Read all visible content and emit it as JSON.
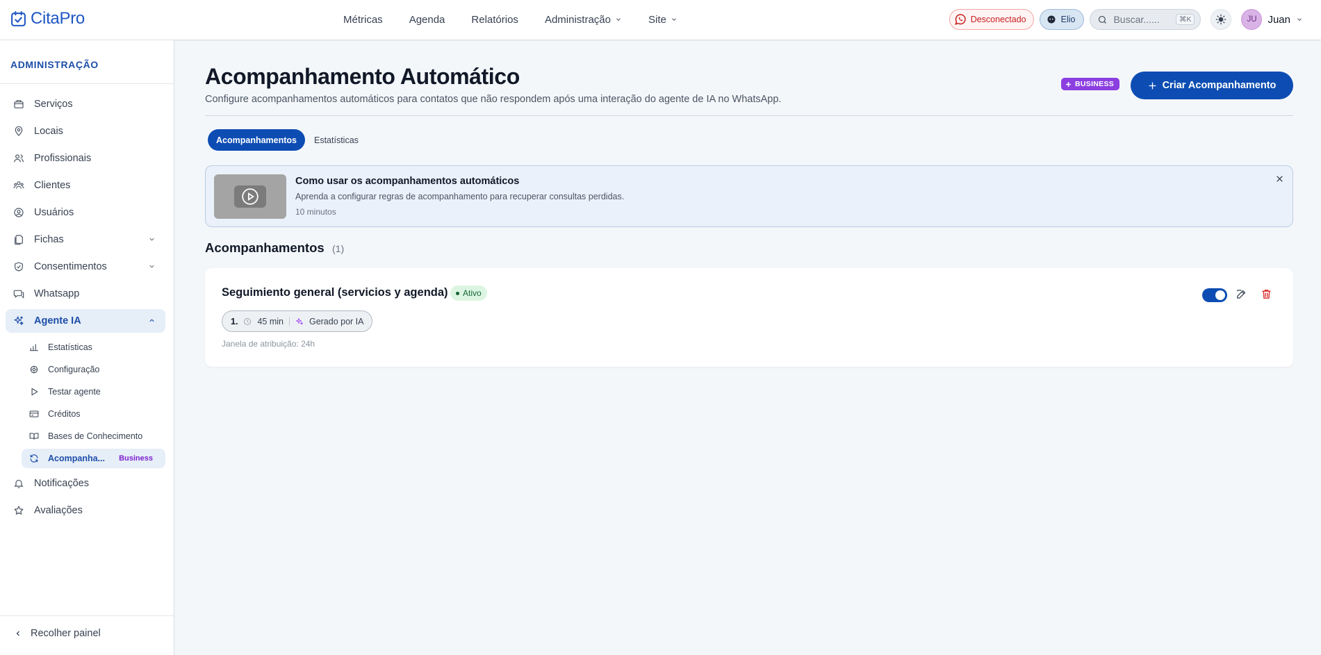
{
  "app": {
    "logo": "CitaPro"
  },
  "nav": {
    "items": [
      "Métricas",
      "Agenda",
      "Relatórios",
      "Administração",
      "Site"
    ]
  },
  "topbar": {
    "whatsapp_status": "Desconectado",
    "agent_name": "Elio",
    "search_placeholder": "Buscar......",
    "search_shortcut": "⌘K",
    "user_initials": "JU",
    "user_name": "Juan"
  },
  "sidebar": {
    "title": "ADMINISTRAÇÃO",
    "items": [
      {
        "label": "Serviços",
        "icon": "box-icon"
      },
      {
        "label": "Locais",
        "icon": "map-pin-icon"
      },
      {
        "label": "Profissionais",
        "icon": "users-icon"
      },
      {
        "label": "Clientes",
        "icon": "clients-icon"
      },
      {
        "label": "Usuários",
        "icon": "user-circle-icon"
      },
      {
        "label": "Fichas",
        "icon": "files-icon"
      },
      {
        "label": "Consentimentos",
        "icon": "shield-check-icon"
      },
      {
        "label": "Whatsapp",
        "icon": "chat-icon"
      },
      {
        "label": "Agente IA",
        "icon": "sparkles-icon"
      }
    ],
    "subitems": [
      {
        "label": "Estatísticas",
        "icon": "bar-chart-icon"
      },
      {
        "label": "Configuração",
        "icon": "settings-icon"
      },
      {
        "label": "Testar agente",
        "icon": "play-icon"
      },
      {
        "label": "Créditos",
        "icon": "credit-card-icon"
      },
      {
        "label": "Bases de Conhecimento",
        "icon": "book-icon"
      },
      {
        "label": "Acompanha...",
        "icon": "refresh-icon",
        "badge": "Business"
      }
    ],
    "bottom_items": [
      {
        "label": "Notificações",
        "icon": "bell-icon"
      },
      {
        "label": "Avaliações",
        "icon": "star-icon"
      }
    ],
    "collapse_label": "Recolher painel"
  },
  "page": {
    "title": "Acompanhamento Automático",
    "subtitle": "Configure acompanhamentos automáticos para contatos que não respondem após uma interação do agente de IA no WhatsApp.",
    "plan_badge": "BUSINESS",
    "create_button": "Criar Acompanhamento",
    "tabs": [
      "Acompanhamentos",
      "Estatísticas"
    ]
  },
  "video_card": {
    "title": "Como usar os acompanhamentos automáticos",
    "description": "Aprenda a configurar regras de acompanhamento para recuperar consultas perdidas.",
    "duration": "10 minutos"
  },
  "list": {
    "title": "Acompanhamentos",
    "count": "(1)",
    "rules": [
      {
        "name": "Seguimiento general (servicios y agenda)",
        "status": "Ativo",
        "step_number": "1.",
        "step_delay": "45 min",
        "step_type": "Gerado por IA",
        "attribution": "Janela de atribuição: 24h",
        "enabled": true
      }
    ]
  },
  "colors": {
    "primary": "#0d4db3",
    "business_purple": "#8b3fe0",
    "danger": "#dc2626",
    "success_bg": "#dcf5e2"
  }
}
